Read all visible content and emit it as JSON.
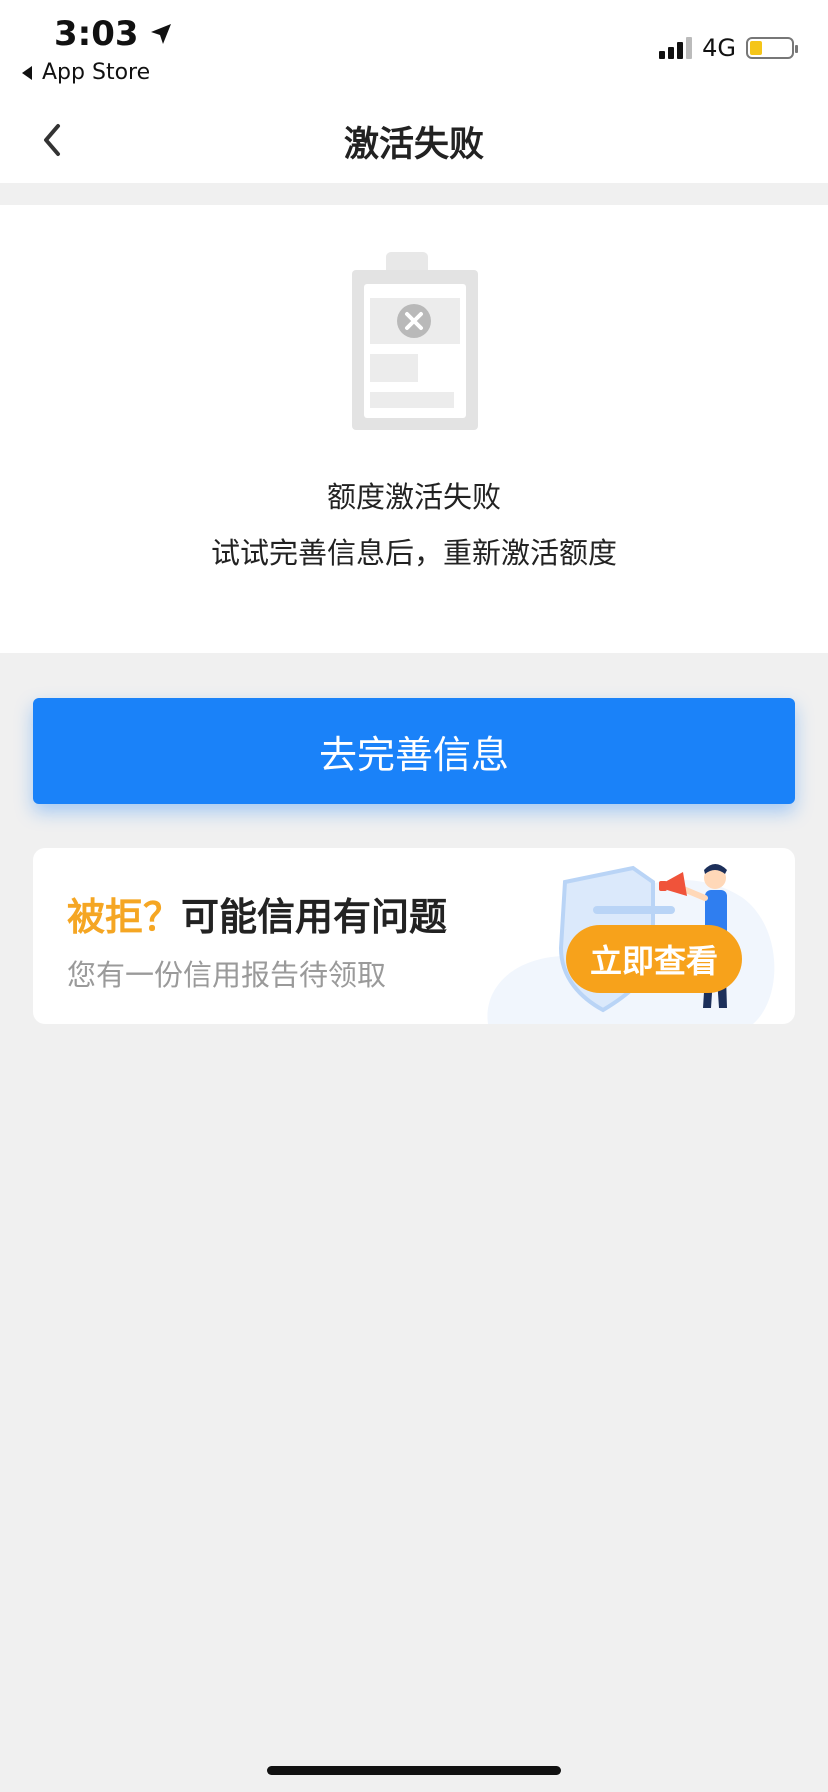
{
  "status_bar": {
    "time": "3:03",
    "back_app": "App Store",
    "network": "4G",
    "location_icon": "location-arrow-icon",
    "signal_icon": "signal-bars-icon",
    "battery_icon": "battery-icon"
  },
  "nav": {
    "title": "激活失败",
    "back_icon": "chevron-left-icon"
  },
  "result": {
    "illustration_icon": "failed-document-icon",
    "message_line1": "额度激活失败",
    "message_line2": "试试完善信息后，重新激活额度"
  },
  "primary_button": {
    "label": "去完善信息",
    "color": "#1a82f9"
  },
  "promo": {
    "title_accent": "被拒？",
    "title_main": "可能信用有问题",
    "subtitle": "您有一份信用报告待领取",
    "button_label": "立即查看",
    "accent_color": "#f5a623",
    "art_icon": "person-megaphone-shield-icon"
  }
}
